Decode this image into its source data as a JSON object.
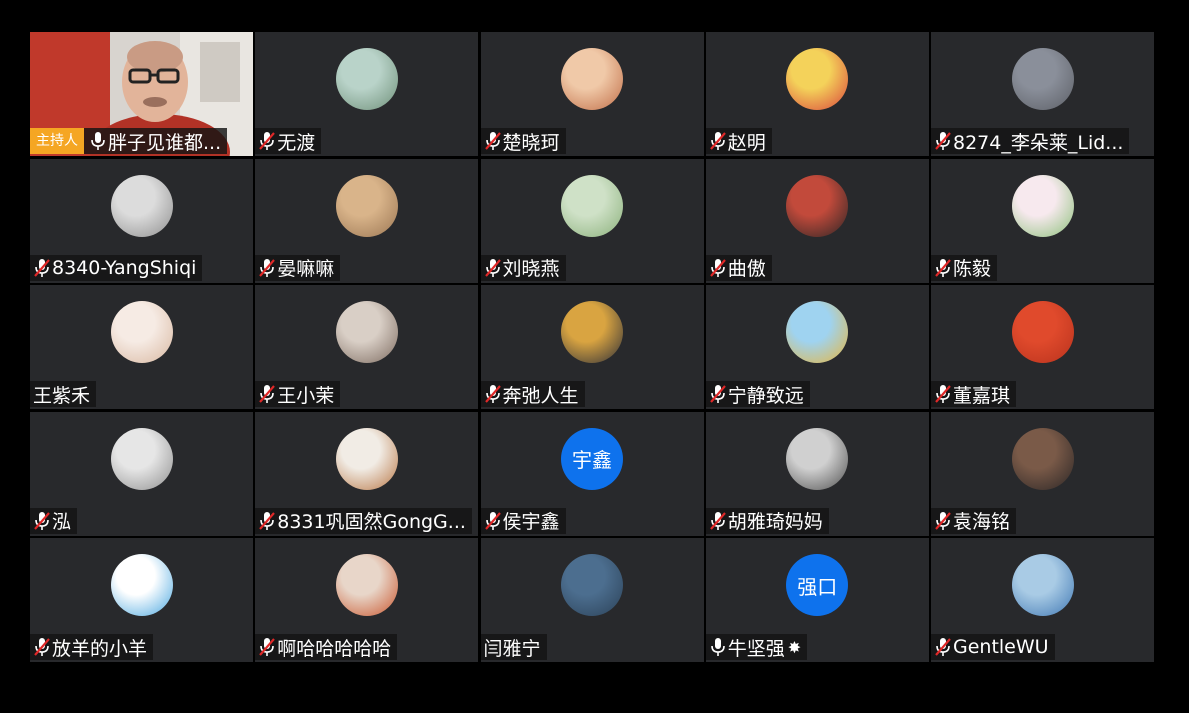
{
  "host_badge": "主持人",
  "participants": [
    {
      "name": "胖子见谁都...",
      "mic": "on",
      "host": true,
      "video": true
    },
    {
      "name": "无渡",
      "mic": "muted",
      "avatar": {
        "type": "image",
        "colors": [
          "#b9d3c9",
          "#6e8f78"
        ],
        "label": "anime-girl-avatar"
      }
    },
    {
      "name": "楚晓珂",
      "mic": "muted",
      "avatar": {
        "type": "image",
        "colors": [
          "#f0c9a8",
          "#c06d47"
        ],
        "label": "child-avatar"
      }
    },
    {
      "name": "赵明",
      "mic": "muted",
      "avatar": {
        "type": "image",
        "colors": [
          "#f4d25a",
          "#d9443b"
        ],
        "label": "cartoon-avatar"
      }
    },
    {
      "name": "8274_李朵莱_Lid...",
      "mic": "muted",
      "avatar": {
        "type": "image",
        "colors": [
          "#8a8f9a",
          "#5c5f66"
        ],
        "label": "cartoon-mouse-avatar"
      }
    },
    {
      "name": "8340-YangShiqi",
      "mic": "muted",
      "avatar": {
        "type": "image",
        "colors": [
          "#dcdcdc",
          "#8e8e8e"
        ],
        "label": "girl-avatar"
      }
    },
    {
      "name": "晏嘛嘛",
      "mic": "muted",
      "avatar": {
        "type": "image",
        "colors": [
          "#d9b48a",
          "#9a7552"
        ],
        "label": "cat-avatar"
      }
    },
    {
      "name": "刘晓燕",
      "mic": "muted",
      "avatar": {
        "type": "image",
        "colors": [
          "#cfe1c7",
          "#8ab07a"
        ],
        "label": "cartoon-face-avatar"
      }
    },
    {
      "name": "曲傲",
      "mic": "muted",
      "avatar": {
        "type": "image",
        "colors": [
          "#c24a3b",
          "#2a2525"
        ],
        "label": "photo-avatar"
      }
    },
    {
      "name": "陈毅",
      "mic": "muted",
      "avatar": {
        "type": "image",
        "colors": [
          "#f7e9ee",
          "#8cc07a"
        ],
        "label": "frog-avatar"
      }
    },
    {
      "name": "王紫禾",
      "mic": "none",
      "avatar": {
        "type": "image",
        "colors": [
          "#f6ebe4",
          "#d8b7a0"
        ],
        "label": "baby-avatar"
      }
    },
    {
      "name": "王小茉",
      "mic": "muted",
      "avatar": {
        "type": "image",
        "colors": [
          "#d9cfc6",
          "#7d6b60"
        ],
        "label": "group-photo-avatar"
      }
    },
    {
      "name": "奔弛人生",
      "mic": "muted",
      "avatar": {
        "type": "image",
        "colors": [
          "#d9a441",
          "#2c2e38"
        ],
        "label": "person-avatar"
      }
    },
    {
      "name": "宁静致远",
      "mic": "muted",
      "avatar": {
        "type": "image",
        "colors": [
          "#9fd3f0",
          "#e7b53d"
        ],
        "label": "field-avatar"
      }
    },
    {
      "name": "董嘉琪",
      "mic": "muted",
      "avatar": {
        "type": "image",
        "colors": [
          "#e04a2c",
          "#b8321d"
        ],
        "label": "red-wall-avatar"
      }
    },
    {
      "name": "泓",
      "mic": "muted",
      "avatar": {
        "type": "image",
        "colors": [
          "#e6e6e6",
          "#8f8f8f"
        ],
        "label": "snow-avatar"
      }
    },
    {
      "name": "8331巩固然GongG...",
      "mic": "muted",
      "avatar": {
        "type": "image",
        "colors": [
          "#f1ece5",
          "#b87644"
        ],
        "label": "cat-avatar"
      }
    },
    {
      "name": "侯宇鑫",
      "mic": "muted",
      "avatar": {
        "type": "text",
        "text": "宇鑫",
        "bg": "#0e72ed"
      }
    },
    {
      "name": "胡雅琦妈妈",
      "mic": "muted",
      "avatar": {
        "type": "image",
        "colors": [
          "#d0d0d0",
          "#505050"
        ],
        "label": "bw-photo-avatar"
      }
    },
    {
      "name": "袁海铭",
      "mic": "muted",
      "avatar": {
        "type": "image",
        "colors": [
          "#7a5a48",
          "#2b2626"
        ],
        "label": "person-avatar"
      }
    },
    {
      "name": "放羊的小羊",
      "mic": "muted",
      "avatar": {
        "type": "image",
        "colors": [
          "#ffffff",
          "#4aa7e0"
        ],
        "label": "sheep-avatar"
      }
    },
    {
      "name": "啊哈哈哈哈哈",
      "mic": "muted",
      "avatar": {
        "type": "image",
        "colors": [
          "#e8d6c9",
          "#c9552c"
        ],
        "label": "person-avatar"
      }
    },
    {
      "name": "闫雅宁",
      "mic": "none",
      "avatar": {
        "type": "image",
        "colors": [
          "#4c6e8f",
          "#2b4157"
        ],
        "label": "blue-avatar"
      }
    },
    {
      "name": "牛坚强",
      "mic": "on",
      "sparkle": true,
      "avatar": {
        "type": "text",
        "text": "强口",
        "bg": "#0e72ed"
      }
    },
    {
      "name": "GentleWU",
      "mic": "muted",
      "avatar": {
        "type": "image",
        "colors": [
          "#a9cbe5",
          "#3f77b3"
        ],
        "label": "blue-art-avatar"
      }
    }
  ]
}
